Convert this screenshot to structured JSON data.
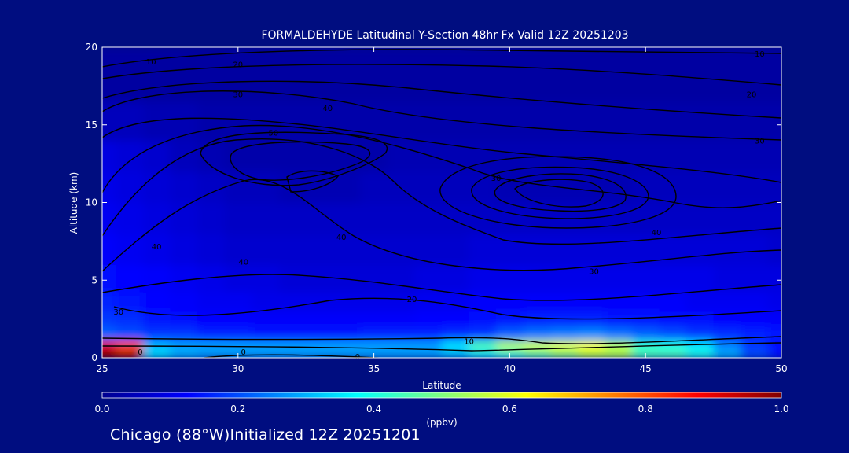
{
  "chart_data": {
    "type": "heatmap",
    "title": "FORMALDEHYDE Latitudinal Y-Section 48hr  Fx Valid 12Z 20251203",
    "xlabel": "Latitude",
    "ylabel": "Altitude (km)",
    "xlim": [
      25,
      50
    ],
    "ylim": [
      0,
      20
    ],
    "x_ticks": [
      "25",
      "30",
      "35",
      "40",
      "45",
      "50"
    ],
    "y_ticks": [
      "0",
      "5",
      "10",
      "15",
      "20"
    ],
    "colorbar": {
      "label": "(ppbv)",
      "range": [
        0.0,
        1.0
      ],
      "ticks": [
        "0.0",
        "0.2",
        "0.4",
        "0.6",
        "0.8",
        "1.0"
      ]
    },
    "color_field": {
      "latitudes": [
        25,
        26,
        27,
        28,
        29,
        30,
        31,
        32,
        33,
        34,
        35,
        36,
        37,
        38,
        39,
        40,
        41,
        42,
        43,
        44,
        45,
        46,
        47,
        48,
        49,
        50
      ],
      "altitudes": [
        0.25,
        0.75,
        1.5,
        2.5,
        3.5,
        5,
        7,
        9,
        11,
        13,
        15,
        18
      ],
      "values": [
        [
          1.0,
          0.95,
          0.35,
          0.3,
          0.28,
          0.28,
          0.28,
          0.28,
          0.28,
          0.28,
          0.28,
          0.28,
          0.28,
          0.3,
          0.35,
          0.4,
          0.45,
          0.5,
          0.55,
          0.55,
          0.45,
          0.45,
          0.4,
          0.3,
          0.2,
          0.15
        ],
        [
          0.9,
          0.8,
          0.3,
          0.28,
          0.28,
          0.28,
          0.28,
          0.28,
          0.28,
          0.28,
          0.28,
          0.28,
          0.28,
          0.35,
          0.45,
          0.55,
          0.58,
          0.6,
          0.62,
          0.55,
          0.42,
          0.4,
          0.35,
          0.25,
          0.18,
          0.14
        ],
        [
          0.22,
          0.2,
          0.18,
          0.18,
          0.16,
          0.16,
          0.15,
          0.15,
          0.15,
          0.15,
          0.16,
          0.16,
          0.16,
          0.17,
          0.18,
          0.22,
          0.24,
          0.25,
          0.26,
          0.24,
          0.22,
          0.2,
          0.18,
          0.17,
          0.16,
          0.15
        ],
        [
          0.18,
          0.17,
          0.15,
          0.14,
          0.13,
          0.13,
          0.12,
          0.12,
          0.12,
          0.12,
          0.12,
          0.12,
          0.13,
          0.13,
          0.14,
          0.15,
          0.16,
          0.16,
          0.16,
          0.15,
          0.15,
          0.14,
          0.14,
          0.13,
          0.13,
          0.12
        ],
        [
          0.16,
          0.15,
          0.13,
          0.12,
          0.11,
          0.11,
          0.1,
          0.1,
          0.1,
          0.1,
          0.1,
          0.1,
          0.11,
          0.11,
          0.12,
          0.12,
          0.12,
          0.12,
          0.12,
          0.12,
          0.12,
          0.12,
          0.11,
          0.11,
          0.11,
          0.1
        ],
        [
          0.14,
          0.13,
          0.12,
          0.11,
          0.1,
          0.09,
          0.09,
          0.08,
          0.08,
          0.08,
          0.08,
          0.08,
          0.09,
          0.09,
          0.1,
          0.1,
          0.1,
          0.1,
          0.1,
          0.1,
          0.1,
          0.1,
          0.1,
          0.09,
          0.09,
          0.09
        ],
        [
          0.12,
          0.11,
          0.1,
          0.09,
          0.08,
          0.07,
          0.07,
          0.07,
          0.07,
          0.07,
          0.07,
          0.07,
          0.07,
          0.07,
          0.08,
          0.08,
          0.08,
          0.08,
          0.08,
          0.08,
          0.08,
          0.08,
          0.08,
          0.08,
          0.08,
          0.07
        ],
        [
          0.11,
          0.1,
          0.09,
          0.08,
          0.07,
          0.06,
          0.06,
          0.06,
          0.06,
          0.06,
          0.06,
          0.06,
          0.06,
          0.06,
          0.06,
          0.06,
          0.06,
          0.06,
          0.06,
          0.06,
          0.06,
          0.06,
          0.06,
          0.06,
          0.06,
          0.06
        ],
        [
          0.1,
          0.09,
          0.08,
          0.07,
          0.06,
          0.05,
          0.05,
          0.04,
          0.04,
          0.04,
          0.05,
          0.05,
          0.05,
          0.05,
          0.05,
          0.04,
          0.04,
          0.04,
          0.04,
          0.04,
          0.05,
          0.05,
          0.05,
          0.05,
          0.05,
          0.05
        ],
        [
          0.09,
          0.08,
          0.07,
          0.05,
          0.04,
          0.03,
          0.03,
          0.03,
          0.03,
          0.03,
          0.03,
          0.04,
          0.04,
          0.04,
          0.04,
          0.04,
          0.04,
          0.04,
          0.04,
          0.04,
          0.04,
          0.04,
          0.04,
          0.04,
          0.04,
          0.04
        ],
        [
          0.05,
          0.05,
          0.04,
          0.04,
          0.03,
          0.03,
          0.03,
          0.03,
          0.03,
          0.03,
          0.03,
          0.03,
          0.03,
          0.03,
          0.03,
          0.03,
          0.03,
          0.03,
          0.03,
          0.03,
          0.03,
          0.03,
          0.03,
          0.03,
          0.03,
          0.03
        ],
        [
          0.02,
          0.02,
          0.02,
          0.02,
          0.02,
          0.02,
          0.02,
          0.02,
          0.02,
          0.02,
          0.02,
          0.02,
          0.02,
          0.02,
          0.02,
          0.02,
          0.02,
          0.02,
          0.02,
          0.02,
          0.02,
          0.02,
          0.02,
          0.02,
          0.02,
          0.02
        ]
      ]
    },
    "contour_labels": [
      {
        "text": "10",
        "lat": 26.8,
        "alt": 19.1
      },
      {
        "text": "20",
        "lat": 30.0,
        "alt": 18.9
      },
      {
        "text": "30",
        "lat": 30.0,
        "alt": 17.0
      },
      {
        "text": "40",
        "lat": 33.3,
        "alt": 16.1
      },
      {
        "text": "50",
        "lat": 31.3,
        "alt": 14.5
      },
      {
        "text": "40",
        "lat": 27.0,
        "alt": 7.2
      },
      {
        "text": "40",
        "lat": 30.2,
        "alt": 6.2
      },
      {
        "text": "30",
        "lat": 25.6,
        "alt": 3.0
      },
      {
        "text": "20",
        "lat": 36.4,
        "alt": 3.8
      },
      {
        "text": "0",
        "lat": 26.4,
        "alt": 0.4
      },
      {
        "text": "0",
        "lat": 30.2,
        "alt": 0.4
      },
      {
        "text": "0",
        "lat": 34.4,
        "alt": 0.1
      },
      {
        "text": "10",
        "lat": 38.5,
        "alt": 1.1
      },
      {
        "text": "40",
        "lat": 33.8,
        "alt": 7.8
      },
      {
        "text": "30",
        "lat": 43.1,
        "alt": 5.6
      },
      {
        "text": "40",
        "lat": 45.4,
        "alt": 8.1
      },
      {
        "text": "10",
        "lat": 49.2,
        "alt": 19.6
      },
      {
        "text": "20",
        "lat": 48.9,
        "alt": 17.0
      },
      {
        "text": "30",
        "lat": 49.2,
        "alt": 14.0
      },
      {
        "text": "30",
        "lat": 39.5,
        "alt": 11.6
      }
    ]
  },
  "footer": {
    "text": "Chicago (88°W)Initialized 12Z 20251201"
  },
  "colors": {
    "background": "#000d80",
    "frame": "#ffffff",
    "contour": "#000000"
  }
}
